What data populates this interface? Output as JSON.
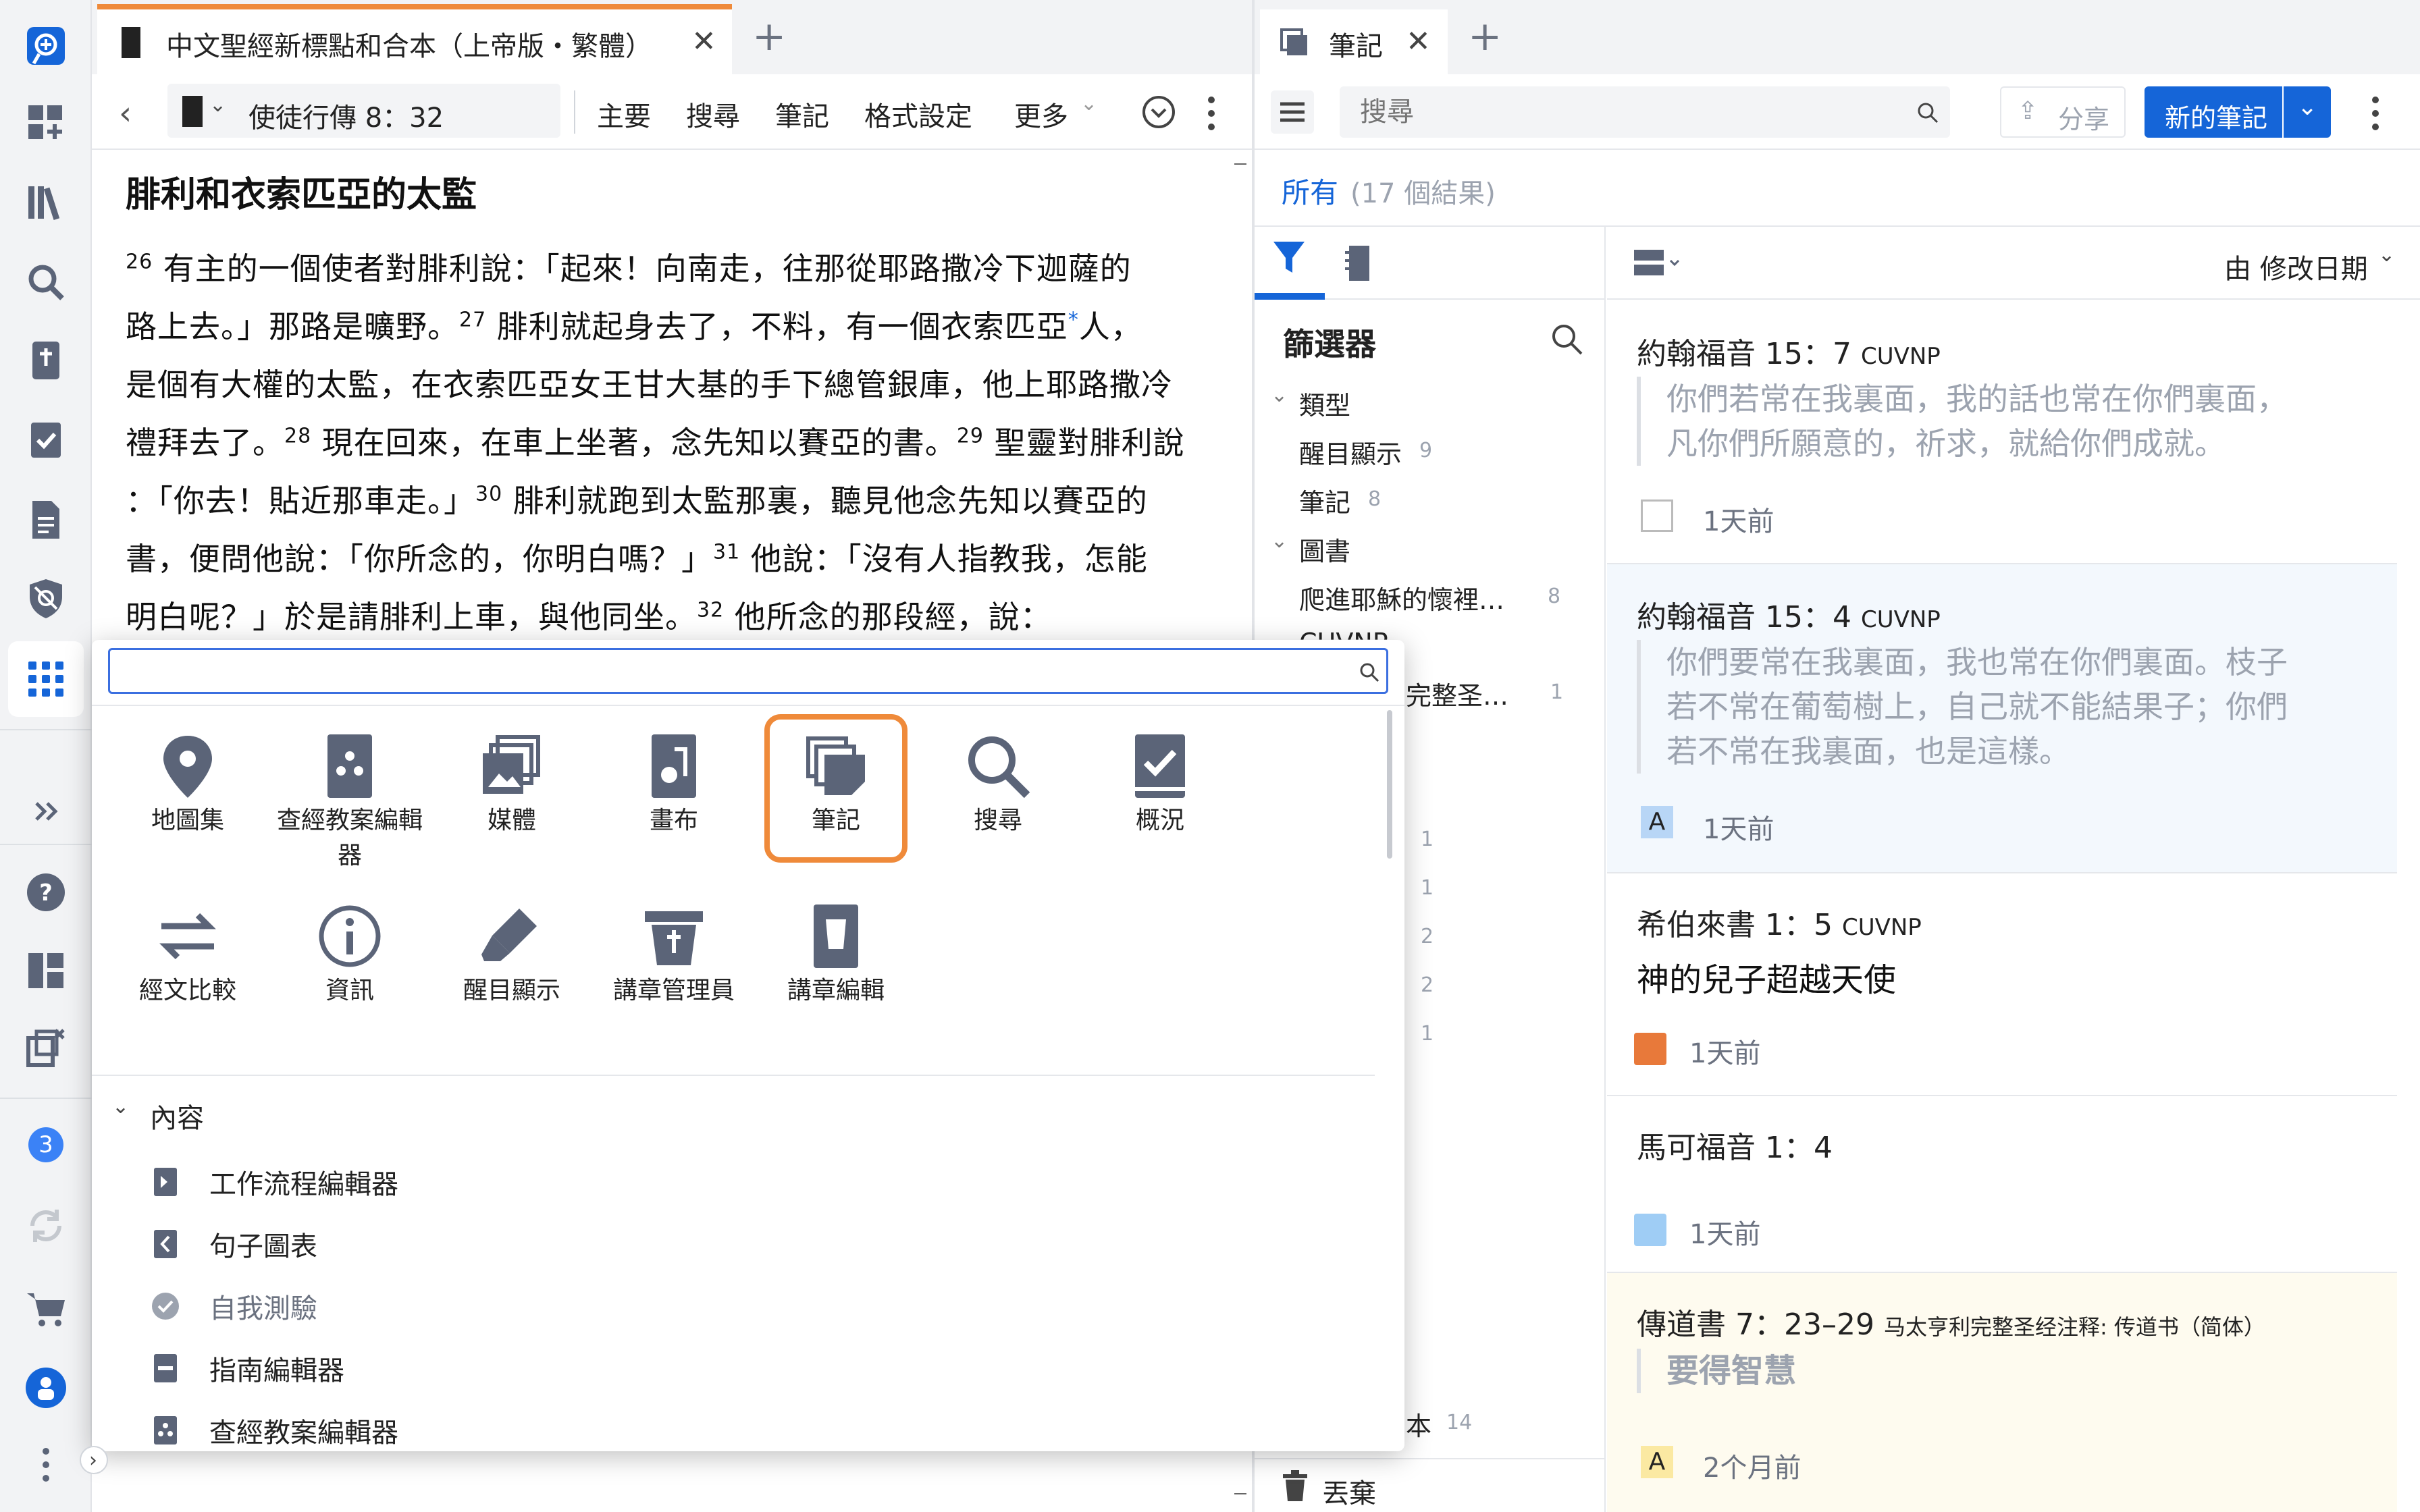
{
  "colors": {
    "accent": "#1565d8",
    "tab_accent": "#ef8a3a",
    "selected_border": "#ef8a3a",
    "icon": "#5b6478"
  },
  "left_tab": {
    "title": "中文聖經新標點和合本（上帝版・繁體）"
  },
  "right_tab": {
    "title": "筆記"
  },
  "bible_toolbar": {
    "reference": "使徒行傳 8：32",
    "menu": [
      "主要",
      "搜尋",
      "筆記",
      "格式設定",
      "更多"
    ]
  },
  "bible": {
    "heading": "腓利和衣索匹亞的太監",
    "lines": [
      {
        "v": "26",
        "t": " 有主的一個使者對腓利說：「起來！向南走，往那從耶路撒冷下迦薩的"
      },
      {
        "v": "",
        "t": "路上去。」那路是曠野。",
        "v2": "27",
        "t2": " 腓利就起身去了，不料，有一個衣索匹亞",
        "m": "*",
        "t3": "人，"
      },
      {
        "v": "",
        "t": "是個有大權的太監，在衣索匹亞女王甘大基的手下總管銀庫，他上耶路撒冷"
      },
      {
        "v": "",
        "t": "禮拜去了。",
        "v2": "28",
        "t2": " 現在回來，在車上坐著，念先知以賽亞的書。",
        "v3": "29",
        "t3": " 聖靈對腓利說"
      },
      {
        "v": "",
        "t": "：「你去！貼近那車走。」",
        "v2": "30",
        "t2": " 腓利就跑到太監那裏，聽見他念先知以賽亞的"
      },
      {
        "v": "",
        "t": "書，便問他說：「你所念的，你明白嗎？」",
        "v2": "31",
        "t2": " 他說：「沒有人指教我，怎能"
      },
      {
        "v": "",
        "t": "明白呢？」於是請腓利上車，與他同坐。",
        "v2": "32",
        "t2": " 他所念的那段經，說："
      }
    ]
  },
  "notes_toolbar": {
    "search_placeholder": "搜尋",
    "share": "分享",
    "new_note": "新的筆記"
  },
  "notes_summary": {
    "all": "所有",
    "count": "(17 個結果)"
  },
  "filter": {
    "title": "篩選器",
    "type_label": "類型",
    "types": [
      {
        "label": "醒目顯示",
        "count": "9"
      },
      {
        "label": "筆記",
        "count": "8"
      }
    ],
    "books_label": "圖書",
    "books": [
      {
        "label": "爬進耶穌的懷裡…",
        "count": "8"
      },
      {
        "label": "CUVNP",
        "count": ""
      },
      {
        "label": "完整圣…",
        "count": "1"
      }
    ],
    "hidden_counts": [
      "1",
      "1",
      "2",
      "2",
      "1"
    ],
    "bottom_item": {
      "label": "本",
      "count": "14"
    },
    "trash": "丟棄"
  },
  "sort": {
    "label": "由 修改日期"
  },
  "notes": [
    {
      "ref": "約翰福音 15：7",
      "ver": "CUVNP",
      "quote": [
        "你們若常在我裏面，我的話也常在你們裏面，",
        "凡你們所願意的，祈求，就給你們成就。"
      ],
      "time": "1天前",
      "badge": ""
    },
    {
      "ref": "約翰福音 15：4",
      "ver": "CUVNP",
      "quote": [
        "你們要常在我裏面，我也常在你們裏面。枝子",
        "若不常在葡萄樹上，自己就不能結果子；你們",
        "若不常在我裏面，也是這樣。"
      ],
      "time": "1天前",
      "badge": "A"
    },
    {
      "ref": "希伯來書 1：5",
      "ver": "CUVNP",
      "title": "神的兒子超越天使",
      "time": "1天前",
      "badge": ""
    },
    {
      "ref": "馬可福音 1：4",
      "ver": "",
      "time": "1天前",
      "badge": ""
    },
    {
      "ref": "傳道書 7：23–29",
      "ver": "马太亨利完整圣经注释: 传道书（简体）",
      "quote": [
        "要得智慧"
      ],
      "time": "2个月前",
      "badge": "A"
    }
  ],
  "popup": {
    "tools_row1": [
      "地圖集",
      "查經教案編輯器",
      "媒體",
      "畫布",
      "筆記",
      "搜尋",
      "概況"
    ],
    "tools_row2": [
      "經文比較",
      "資訊",
      "醒目顯示",
      "講章管理員",
      "講章編輯"
    ],
    "section": "內容",
    "content_items": [
      "工作流程編輯器",
      "句子圖表",
      "自我測驗",
      "指南編輯器",
      "查經教案編輯器"
    ]
  },
  "sidebar": {
    "badge": "3"
  }
}
